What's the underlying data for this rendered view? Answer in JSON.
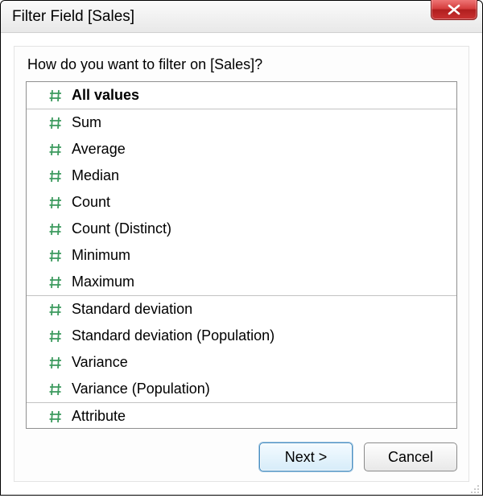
{
  "window": {
    "title": "Filter Field [Sales]"
  },
  "prompt": "How do you want to filter on [Sales]?",
  "options": {
    "group0": [
      {
        "label": "All values",
        "selected": true
      }
    ],
    "group1": [
      {
        "label": "Sum"
      },
      {
        "label": "Average"
      },
      {
        "label": "Median"
      },
      {
        "label": "Count"
      },
      {
        "label": "Count (Distinct)"
      },
      {
        "label": "Minimum"
      },
      {
        "label": "Maximum"
      }
    ],
    "group2": [
      {
        "label": "Standard deviation"
      },
      {
        "label": "Standard deviation (Population)"
      },
      {
        "label": "Variance"
      },
      {
        "label": "Variance (Population)"
      }
    ],
    "group3": [
      {
        "label": "Attribute"
      }
    ]
  },
  "buttons": {
    "next": "Next >",
    "cancel": "Cancel"
  },
  "colors": {
    "icon": "#3c9a5e",
    "close_bg": "#c93232",
    "primary_border": "#4a90c3"
  }
}
